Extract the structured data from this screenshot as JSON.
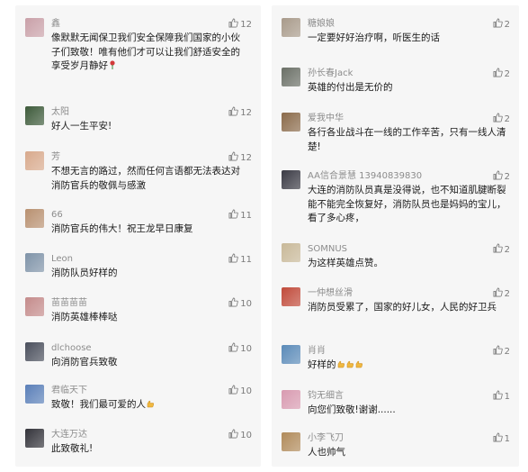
{
  "left": [
    {
      "name": "鑫",
      "text": "像默默无闻保卫我们安全保障我们国家的小伙子们致敬！唯有他们才可以让我们舒适安全的享受岁月静好",
      "emoji": "rose",
      "likes": "12",
      "avatar": "#c9a0a8"
    },
    {
      "name": "太阳",
      "text": "好人一生平安!",
      "likes": "12",
      "avatar": "#3d5a3a"
    },
    {
      "name": "芳",
      "text": "不想无言的路过，然而任何言语都无法表达对消防官兵的敬佩与感激",
      "likes": "12",
      "avatar": "#d8a98c"
    },
    {
      "name": "66",
      "text": "消防官兵的伟大！祝王龙早日康复",
      "likes": "11",
      "avatar": "#b89070"
    },
    {
      "name": "Leon",
      "text": "消防队员好样的",
      "likes": "11",
      "avatar": "#7f93a8"
    },
    {
      "name": "苗苗苗苗",
      "text": "消防英雄棒棒哒",
      "likes": "10",
      "avatar": "#c48b8b"
    },
    {
      "name": "dlchoose",
      "text": "向消防官兵致敬",
      "likes": "10",
      "avatar": "#4a4f5c"
    },
    {
      "name": "君临天下",
      "text": "致敬！我们最可爱的人",
      "emoji": "thumb",
      "likes": "10",
      "avatar": "#5a7fb8"
    },
    {
      "name": "大连万达",
      "text": "此致敬礼!",
      "likes": "10",
      "avatar": "#33333a"
    }
  ],
  "right": [
    {
      "name": "糖娘娘",
      "text": "一定要好好治疗啊，听医生的话",
      "likes": "2",
      "avatar": "#a89a8a"
    },
    {
      "name": "孙长春Jack",
      "text": "英雄的付出是无价的",
      "likes": "2",
      "avatar": "#6a6f66"
    },
    {
      "name": "爱我中华",
      "text": "各行各业战斗在一线的工作辛苦，只有一线人清楚!",
      "likes": "2",
      "avatar": "#8a6a4a"
    },
    {
      "name": "AA信合景慧 13940839830",
      "text": "大连的消防队员真是没得说，也不知道肌腱断裂能不能完全恢复好，消防队员也是妈妈的宝儿，看了多心疼，",
      "likes": "2",
      "avatar": "#3a3a44"
    },
    {
      "name": "SOMNUS",
      "text": "为这样英雄点赞。",
      "likes": "2",
      "avatar": "#c8b898"
    },
    {
      "name": "一仲想丝滑",
      "text": "消防员受累了，国家的好儿女，人民的好卫兵",
      "likes": "2",
      "avatar": "#c04a3a"
    },
    {
      "name": "肖肖",
      "text": "好样的",
      "emoji": "thumbs3",
      "likes": "2",
      "avatar": "#5a8ab8"
    },
    {
      "name": "钧无细言",
      "text": "向您们致敬!谢谢......",
      "likes": "1",
      "avatar": "#d89ab0"
    },
    {
      "name": "小李飞刀",
      "text": "人也帅气",
      "likes": "1",
      "avatar": "#b08a5a"
    }
  ],
  "colors": {
    "panel": "#f6f6f6",
    "name": "#8c8c8c",
    "text": "#1a1a1a"
  }
}
